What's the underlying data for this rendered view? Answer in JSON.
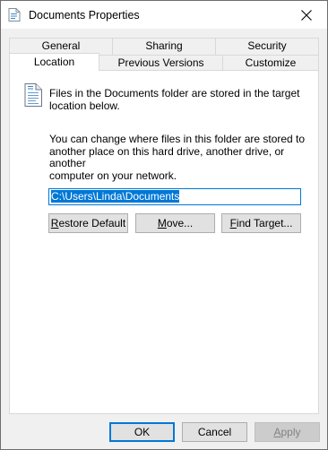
{
  "window": {
    "title": "Documents Properties",
    "close_icon": "close-icon",
    "app_icon": "folder-properties-icon"
  },
  "tabs_row1": [
    {
      "label": "General"
    },
    {
      "label": "Sharing"
    },
    {
      "label": "Security"
    }
  ],
  "tabs_row2": [
    {
      "label": "Location",
      "active": true
    },
    {
      "label": "Previous Versions"
    },
    {
      "label": "Customize"
    }
  ],
  "location": {
    "info_icon": "documents-folder-icon",
    "info_line1": "Files in the Documents folder are stored in the target",
    "info_line2": "location below.",
    "desc_line1": "You can change where files in this folder are stored to",
    "desc_line2": "another place on this hard drive, another drive, or another",
    "desc_line3": "computer on your network.",
    "path_value": "C:\\Users\\Linda\\Documents",
    "restore_label": {
      "u": "R",
      "rest": "estore Default"
    },
    "move_label": {
      "u": "M",
      "rest": "ove..."
    },
    "find_label": {
      "u": "F",
      "rest": "ind Target..."
    }
  },
  "footer": {
    "ok_label": "OK",
    "cancel_label": "Cancel",
    "apply_label": {
      "u": "A",
      "rest": "pply"
    },
    "apply_disabled": true
  },
  "colors": {
    "accent": "#0078d7",
    "face": "#f0f0f0",
    "panel": "#ffffff",
    "disabled_text": "#838383"
  }
}
